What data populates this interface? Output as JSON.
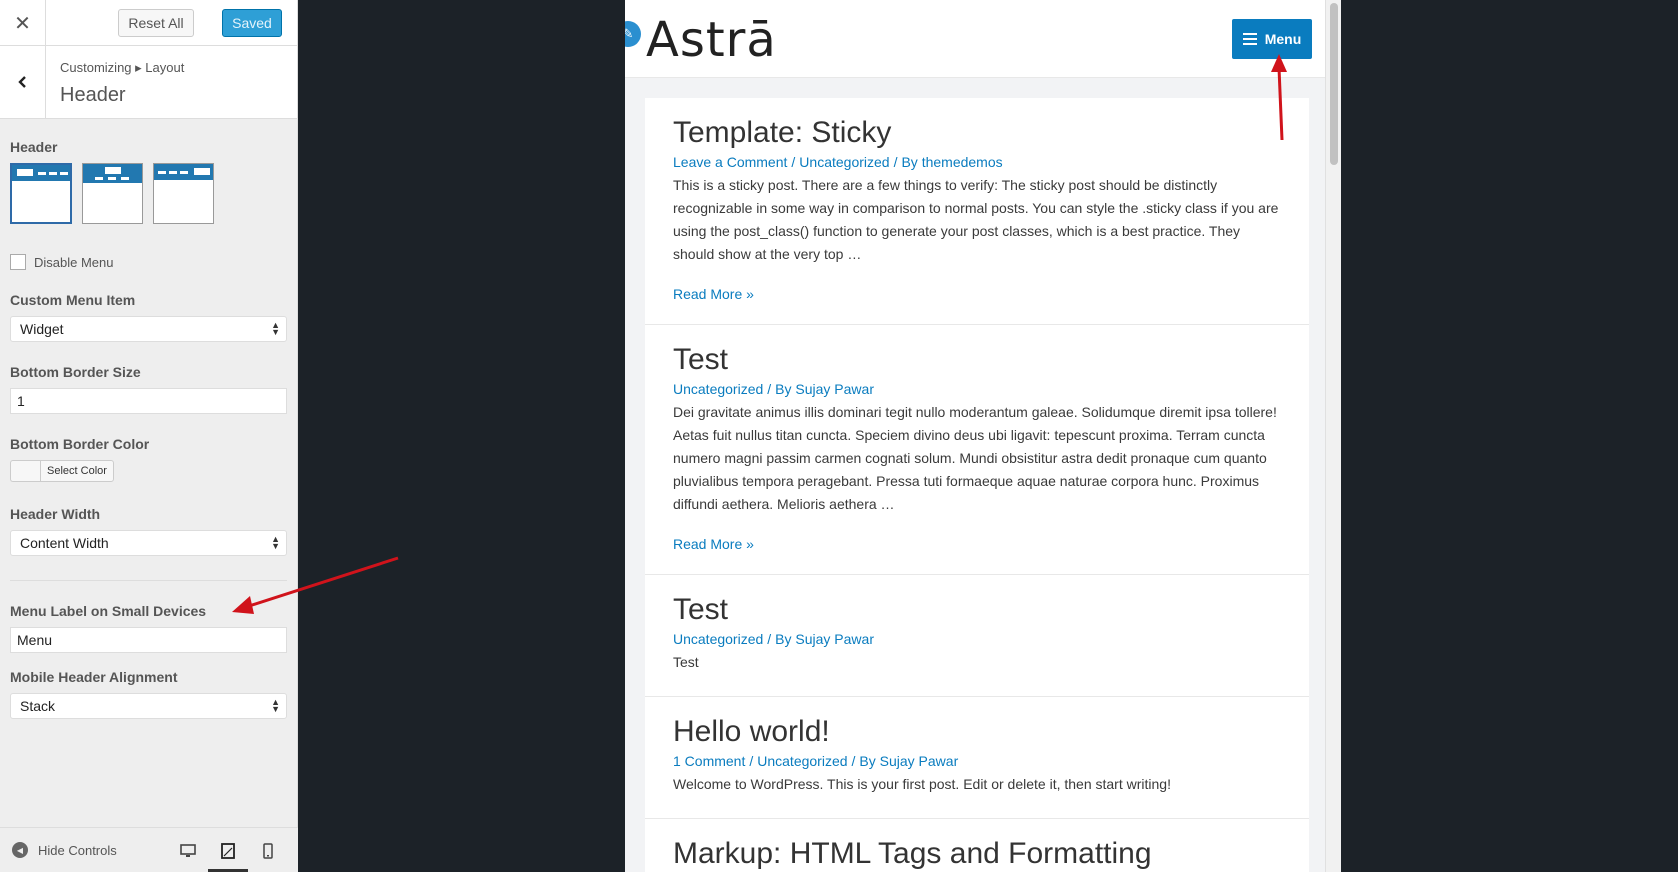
{
  "topbar": {
    "close_icon": "close-icon",
    "reset_label": "Reset All",
    "saved_label": "Saved"
  },
  "section": {
    "breadcrumb": "Customizing ▸ Layout",
    "title": "Header"
  },
  "controls": {
    "header_label": "Header",
    "disable_menu_label": "Disable Menu",
    "custom_menu_item_label": "Custom Menu Item",
    "custom_menu_item_value": "Widget",
    "bottom_border_size_label": "Bottom Border Size",
    "bottom_border_size_value": "1",
    "bottom_border_color_label": "Bottom Border Color",
    "select_color_label": "Select Color",
    "header_width_label": "Header Width",
    "header_width_value": "Content Width",
    "menu_label_small_label": "Menu Label on Small Devices",
    "menu_label_small_value": "Menu",
    "mobile_header_alignment_label": "Mobile Header Alignment",
    "mobile_header_alignment_value": "Stack"
  },
  "footer": {
    "hide_controls_label": "Hide Controls"
  },
  "site": {
    "logo_text": "Astrā",
    "menu_label": "Menu"
  },
  "posts": [
    {
      "title": "Template: Sticky",
      "meta": [
        "Leave a Comment",
        "Uncategorized",
        "By themedemos"
      ],
      "excerpt": "This is a sticky post. There are a few things to verify: The sticky post should be distinctly recognizable in some way in comparison to normal posts. You can style the .sticky class if you are using the post_class() function to generate your post classes, which is a best practice. They should show at the very top …",
      "read_more": "Read More »"
    },
    {
      "title": "Test",
      "meta": [
        "Uncategorized",
        "By Sujay Pawar"
      ],
      "excerpt": "Dei gravitate animus illis dominari tegit nullo moderantum galeae. Solidumque diremit ipsa tollere! Aetas fuit nullus titan cuncta. Speciem divino deus ubi ligavit: tepescunt proxima. Terram cuncta numero magni passim carmen cognati solum. Mundi obsistitur astra dedit pronaque cum quanto pluvialibus tempora peragebant. Pressa tuti formaeque aquae naturae corpora hunc. Proximus diffundi aethera. Melioris aethera …",
      "read_more": "Read More »"
    },
    {
      "title": "Test",
      "meta": [
        "Uncategorized",
        "By Sujay Pawar"
      ],
      "excerpt": "Test",
      "read_more": ""
    },
    {
      "title": "Hello world!",
      "meta": [
        "1 Comment",
        "Uncategorized",
        "By Sujay Pawar"
      ],
      "excerpt": "Welcome to WordPress. This is your first post. Edit or delete it, then start writing!",
      "read_more": ""
    },
    {
      "title": "Markup: HTML Tags and Formatting",
      "meta": [],
      "excerpt": "",
      "read_more": ""
    }
  ],
  "colors": {
    "accent": "#0a7cbf",
    "annotation": "#d0131b"
  }
}
